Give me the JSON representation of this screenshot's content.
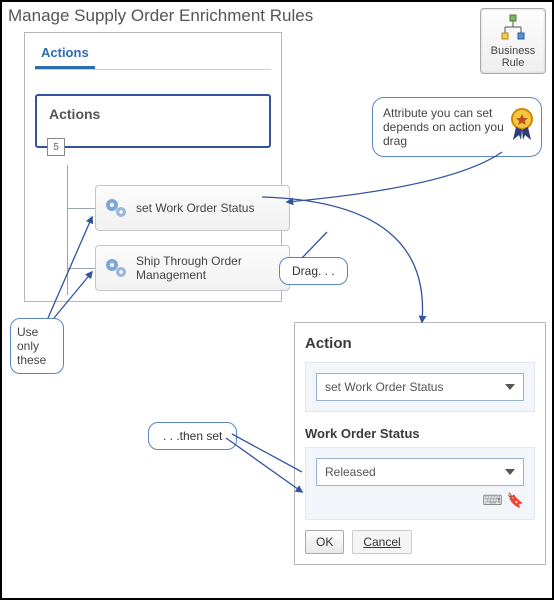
{
  "page_title": "Manage Supply Order Enrichment Rules",
  "business_rule": {
    "line1": "Business",
    "line2": "Rule"
  },
  "attr_callout": "Attribute you can set depends on action you drag",
  "actions_panel": {
    "tab_label": "Actions",
    "root_label": "Actions",
    "root_count": "5",
    "cards": [
      "set Work Order Status",
      "Ship Through Order Management"
    ]
  },
  "use_only": "Use only these",
  "drag_label": "Drag. . .",
  "then_set": ". . .then set",
  "dest": {
    "heading": "Action",
    "action_value": "set Work Order Status",
    "sub_heading": "Work Order Status",
    "status_value": "Released",
    "ok": "OK",
    "cancel": "Cancel"
  }
}
